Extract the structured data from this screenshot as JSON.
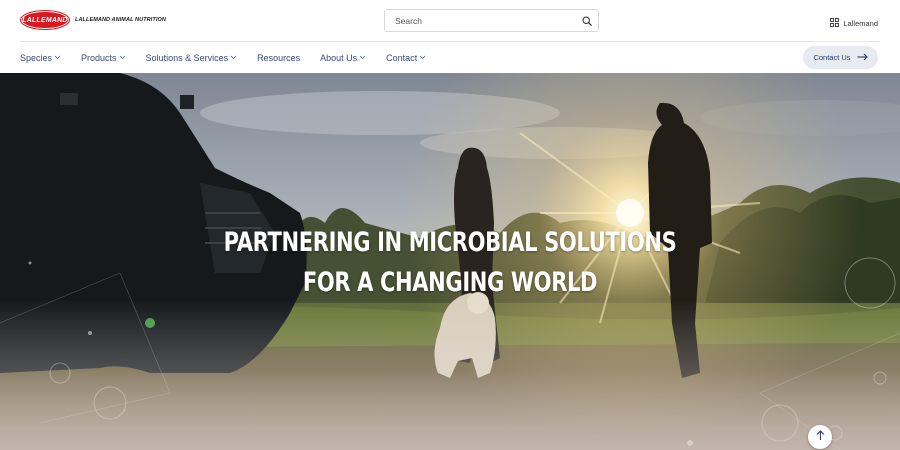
{
  "brand": {
    "logo_text": "LALLEMAND",
    "subtitle": "LALLEMAND ANIMAL NUTRITION",
    "primary_color": "#d71920"
  },
  "search": {
    "placeholder": "Search",
    "icon": "search-icon"
  },
  "apps_menu": {
    "label": "Lallemand",
    "icon": "grid-icon"
  },
  "nav": {
    "items": [
      {
        "label": "Species",
        "has_dropdown": true
      },
      {
        "label": "Products",
        "has_dropdown": true
      },
      {
        "label": "Solutions & Services",
        "has_dropdown": true
      },
      {
        "label": "Resources",
        "has_dropdown": false
      },
      {
        "label": "About Us",
        "has_dropdown": true
      },
      {
        "label": "Contact",
        "has_dropdown": true
      }
    ],
    "contact_button": "Contact Us"
  },
  "hero": {
    "title_line1": "PARTNERING IN MICROBIAL SOLUTIONS",
    "title_line2": "FOR A CHANGING WORLD",
    "scroll_top_icon": "arrow-up-icon"
  }
}
